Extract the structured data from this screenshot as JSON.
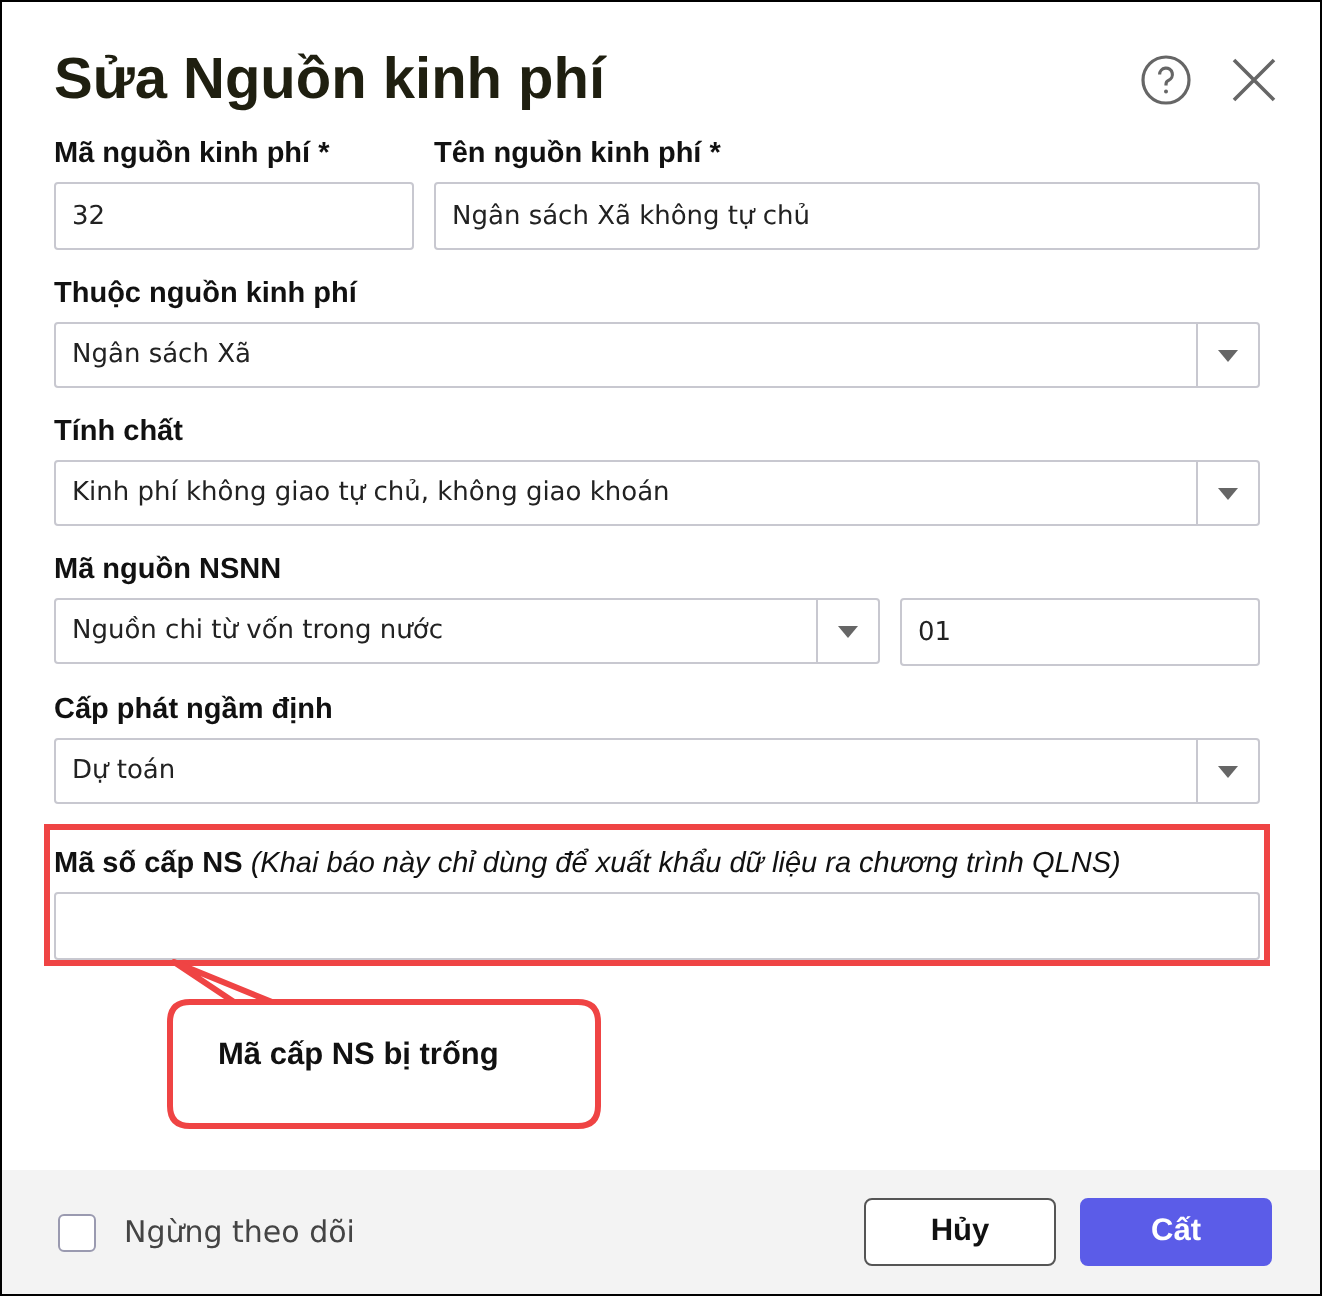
{
  "dialog": {
    "title": "Sửa Nguồn kinh phí"
  },
  "rows": [
    {
      "labels": [
        "Mã nguồn kinh phí *",
        "Tên nguồn kinh phí *"
      ],
      "controls": [
        {
          "kind": "text",
          "value": "32"
        },
        {
          "kind": "text",
          "value": "Ngân sách Xã không tự chủ"
        }
      ]
    },
    {
      "labels": [
        "Thuộc nguồn kinh phí"
      ],
      "controls": [
        {
          "kind": "select",
          "value": "Ngân sách Xã"
        }
      ]
    },
    {
      "labels": [
        "Tính chất"
      ],
      "controls": [
        {
          "kind": "select",
          "value": "Kinh phí không giao tự chủ, không giao khoán"
        }
      ]
    },
    {
      "labels": [
        "Mã nguồn NSNN"
      ],
      "controls": [
        {
          "kind": "select",
          "value": "Nguồn chi từ vốn trong nước"
        },
        {
          "kind": "text",
          "value": "01"
        }
      ]
    },
    {
      "labels": [
        "Cấp phát ngầm định"
      ],
      "controls": [
        {
          "kind": "select",
          "value": "Dự toán"
        }
      ]
    },
    {
      "labels": [
        "**Mã số cấp NS** *(Khai báo này chỉ dùng để xuất khẩu dữ liệu ra chương trình QLNS)*"
      ],
      "controls": [
        {
          "kind": "text"
        }
      ],
      "highlighted": true
    }
  ],
  "callout": {
    "text": "Mã cấp NS bị trống"
  },
  "footer": {
    "checkbox": {
      "label": "Ngừng theo dõi",
      "checked": false
    },
    "buttons": [
      {
        "label": "Hủy",
        "kind": "secondary"
      },
      {
        "label": "Cất",
        "kind": "primary"
      }
    ]
  }
}
